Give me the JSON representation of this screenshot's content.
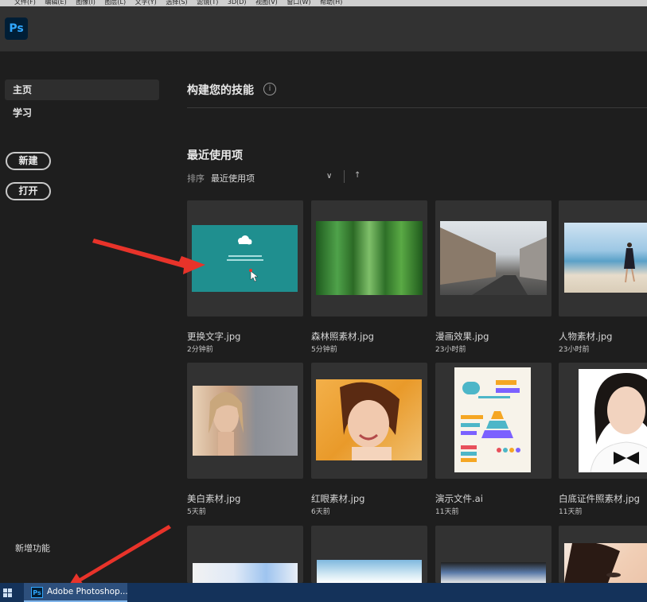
{
  "menubar": {
    "items": [
      "文件(F)",
      "编辑(E)",
      "图像(I)",
      "图层(L)",
      "文字(Y)",
      "选择(S)",
      "滤镜(T)",
      "3D(D)",
      "视图(V)",
      "窗口(W)",
      "帮助(H)"
    ]
  },
  "app": {
    "logo": "Ps"
  },
  "sidebar": {
    "nav": [
      {
        "label": "主页",
        "active": true
      },
      {
        "label": "学习",
        "active": false
      }
    ],
    "new_label": "新建",
    "open_label": "打开",
    "whats_new": "新增功能"
  },
  "main": {
    "skills_heading": "构建您的技能",
    "info_glyph": "i",
    "recent_heading": "最近使用项",
    "sort_label": "排序",
    "sort_value": "最近使用项",
    "sort_chevron": "∨",
    "sort_direction": "↑",
    "files": [
      {
        "name": "更换文字.jpg",
        "time": "2分钟前"
      },
      {
        "name": "森林照素材.jpg",
        "time": "5分钟前"
      },
      {
        "name": "漫画效果.jpg",
        "time": "23小时前"
      },
      {
        "name": "人物素材.jpg",
        "time": "23小时前"
      },
      {
        "name": "美白素材.jpg",
        "time": "5天前"
      },
      {
        "name": "红眼素材.jpg",
        "time": "6天前"
      },
      {
        "name": "演示文件.ai",
        "time": "11天前"
      },
      {
        "name": "白底证件照素材.jpg",
        "time": "11天前"
      }
    ]
  },
  "taskbar": {
    "app_label": "Adobe Photoshop...",
    "app_icon": "Ps"
  },
  "colors": {
    "background": "#1e1e1e",
    "card": "#323232",
    "ps_blue": "#31a8ff",
    "arrow_red": "#e8332a",
    "taskbar": "#14325a"
  }
}
